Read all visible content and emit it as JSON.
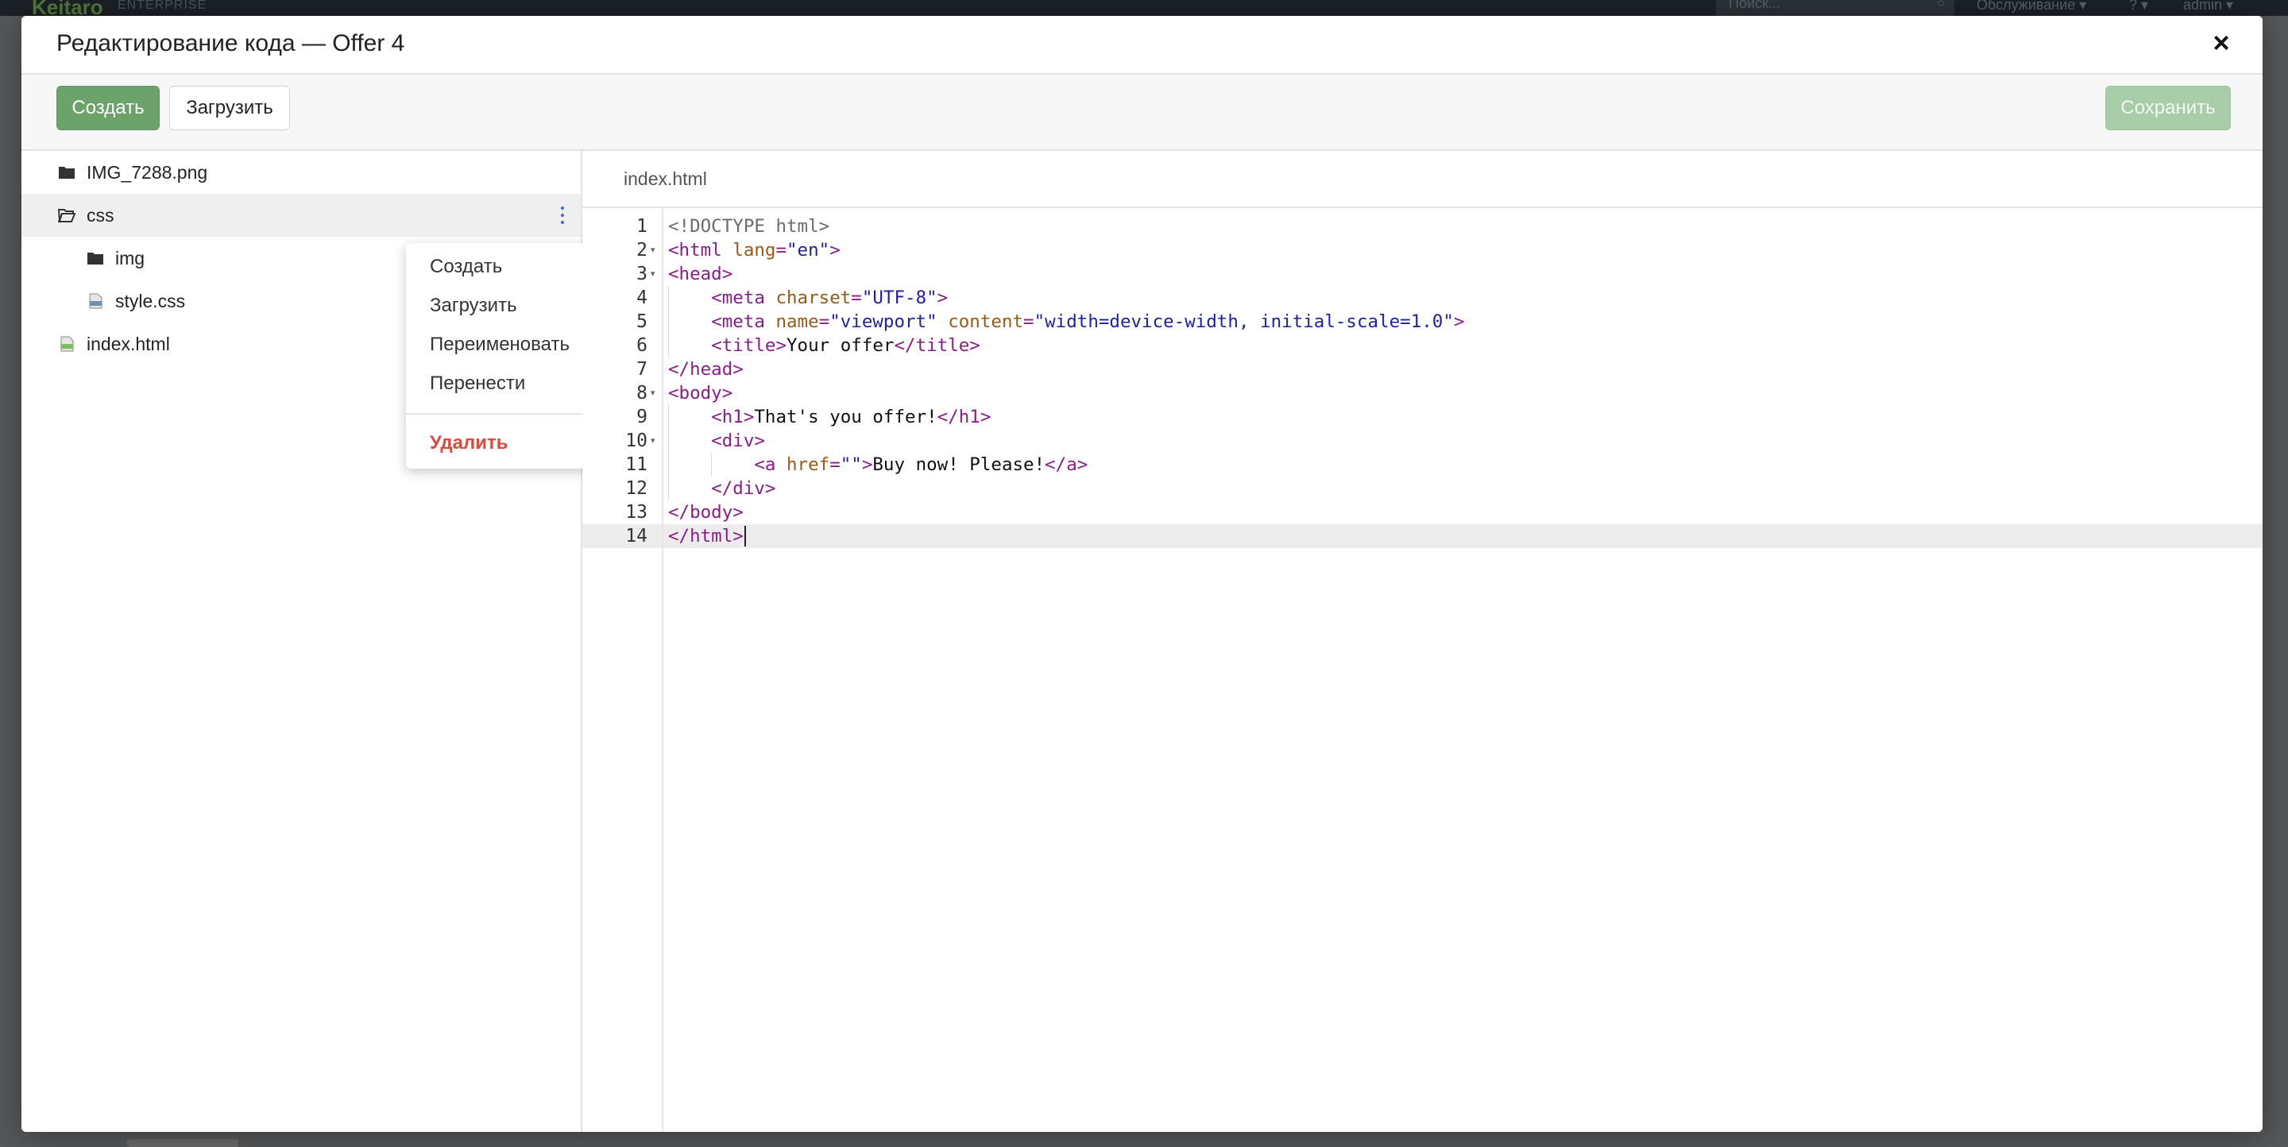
{
  "background": {
    "logo": "Keitaro",
    "logo_sub": "ENTERPRISE",
    "search_placeholder": "Поиск...",
    "menu": [
      "Обслуживание ▾",
      "? ▾",
      "admin ▾"
    ]
  },
  "modal": {
    "title": "Редактирование кода — Offer 4",
    "close_symbol": "×"
  },
  "toolbar": {
    "create_label": "Создать",
    "upload_label": "Загрузить",
    "save_label": "Сохранить"
  },
  "tree": {
    "items": [
      {
        "label": "IMG_7288.png",
        "icon": "folder-icon",
        "depth": 0
      },
      {
        "label": "css",
        "icon": "folder-open-icon",
        "depth": 0,
        "selected": true
      },
      {
        "label": "img",
        "icon": "folder-icon",
        "depth": 1
      },
      {
        "label": "style.css",
        "icon": "file-css-icon",
        "depth": 1
      },
      {
        "label": "index.html",
        "icon": "file-html-icon",
        "depth": 0
      }
    ]
  },
  "context_menu": {
    "items": [
      "Создать",
      "Загрузить",
      "Переименовать",
      "Перенести"
    ],
    "delete_label": "Удалить"
  },
  "editor": {
    "tab_label": "index.html",
    "active_line": 14,
    "fold_lines": [
      2,
      3,
      8,
      10
    ],
    "lines": [
      [
        {
          "t": "doctype",
          "v": "<!DOCTYPE html>"
        }
      ],
      [
        {
          "t": "tag",
          "v": "<html "
        },
        {
          "t": "attr",
          "v": "lang"
        },
        {
          "t": "tag",
          "v": "="
        },
        {
          "t": "str",
          "v": "\"en\""
        },
        {
          "t": "tag",
          "v": ">"
        }
      ],
      [
        {
          "t": "tag",
          "v": "<head>"
        }
      ],
      [
        {
          "t": "text",
          "v": "    "
        },
        {
          "t": "tag",
          "v": "<meta "
        },
        {
          "t": "attr",
          "v": "charset"
        },
        {
          "t": "tag",
          "v": "="
        },
        {
          "t": "str",
          "v": "\"UTF-8\""
        },
        {
          "t": "tag",
          "v": ">"
        }
      ],
      [
        {
          "t": "text",
          "v": "    "
        },
        {
          "t": "tag",
          "v": "<meta "
        },
        {
          "t": "attr",
          "v": "name"
        },
        {
          "t": "tag",
          "v": "="
        },
        {
          "t": "str",
          "v": "\"viewport\""
        },
        {
          "t": "text",
          "v": " "
        },
        {
          "t": "attr",
          "v": "content"
        },
        {
          "t": "tag",
          "v": "="
        },
        {
          "t": "str",
          "v": "\"width=device-width, initial-scale=1.0\""
        },
        {
          "t": "tag",
          "v": ">"
        }
      ],
      [
        {
          "t": "text",
          "v": "    "
        },
        {
          "t": "tag",
          "v": "<title>"
        },
        {
          "t": "text",
          "v": "Your offer"
        },
        {
          "t": "tag",
          "v": "</title>"
        }
      ],
      [
        {
          "t": "tag",
          "v": "</head>"
        }
      ],
      [
        {
          "t": "tag",
          "v": "<body>"
        }
      ],
      [
        {
          "t": "text",
          "v": "    "
        },
        {
          "t": "tag",
          "v": "<h1>"
        },
        {
          "t": "text",
          "v": "That's you offer!"
        },
        {
          "t": "tag",
          "v": "</h1>"
        }
      ],
      [
        {
          "t": "text",
          "v": "    "
        },
        {
          "t": "tag",
          "v": "<div>"
        }
      ],
      [
        {
          "t": "text",
          "v": "        "
        },
        {
          "t": "tag",
          "v": "<a "
        },
        {
          "t": "attr",
          "v": "href"
        },
        {
          "t": "tag",
          "v": "="
        },
        {
          "t": "str",
          "v": "\"\""
        },
        {
          "t": "tag",
          "v": ">"
        },
        {
          "t": "text",
          "v": "Buy now! Please!"
        },
        {
          "t": "tag",
          "v": "</a>"
        }
      ],
      [
        {
          "t": "text",
          "v": "    "
        },
        {
          "t": "tag",
          "v": "</div>"
        }
      ],
      [
        {
          "t": "tag",
          "v": "</body>"
        }
      ],
      [
        {
          "t": "tag",
          "v": "</html>"
        }
      ]
    ]
  }
}
